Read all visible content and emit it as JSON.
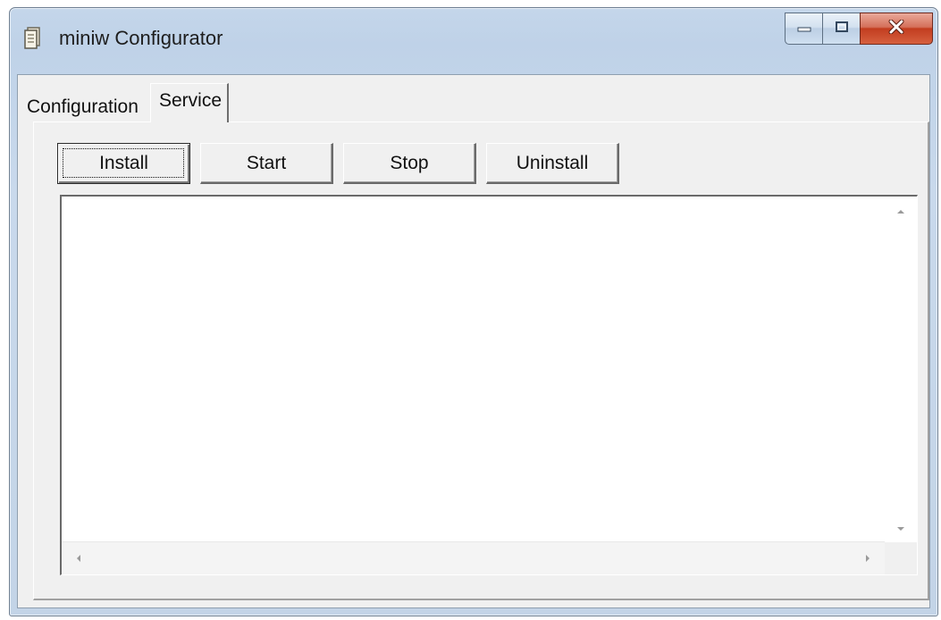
{
  "window": {
    "title": "miniw Configurator",
    "icon": "document-icon"
  },
  "caption_buttons": {
    "minimize_icon": "minimize-icon",
    "maximize_icon": "maximize-icon",
    "close_icon": "close-icon"
  },
  "tabs": [
    {
      "label": "Configuration",
      "selected": false
    },
    {
      "label": "Service",
      "selected": true
    }
  ],
  "service": {
    "buttons": {
      "install": "Install",
      "start": "Start",
      "stop": "Stop",
      "uninstall": "Uninstall"
    },
    "log_text": ""
  },
  "colors": {
    "close_button": "#c23d1f",
    "window_frame": "#c4d6ea",
    "client_background": "#f0f0f0"
  }
}
